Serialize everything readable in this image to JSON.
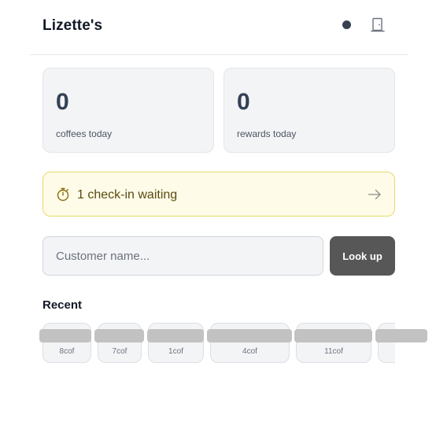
{
  "header": {
    "shop_name": "Lizette's",
    "status_color": "#374151",
    "exit_icon": "exit-door-icon"
  },
  "stats": [
    {
      "value": "0",
      "label": "coffees today"
    },
    {
      "value": "0",
      "label": "rewards today"
    }
  ],
  "checkin": {
    "icon": "stopwatch-icon",
    "text": "1 check-in waiting",
    "arrow_icon": "arrow-right-icon"
  },
  "search": {
    "value": "",
    "placeholder": "Customer name...",
    "button_label": "Look up"
  },
  "recent": {
    "title": "Recent",
    "items": [
      {
        "count": "8cof"
      },
      {
        "count": "7cof"
      },
      {
        "count": "1cof"
      },
      {
        "count": "4cof"
      },
      {
        "count": "11cof"
      },
      {
        "count": ""
      }
    ]
  },
  "colors": {
    "banner_bg": "#fefce8",
    "banner_border": "#e6d96a",
    "button_bg": "#575757"
  }
}
